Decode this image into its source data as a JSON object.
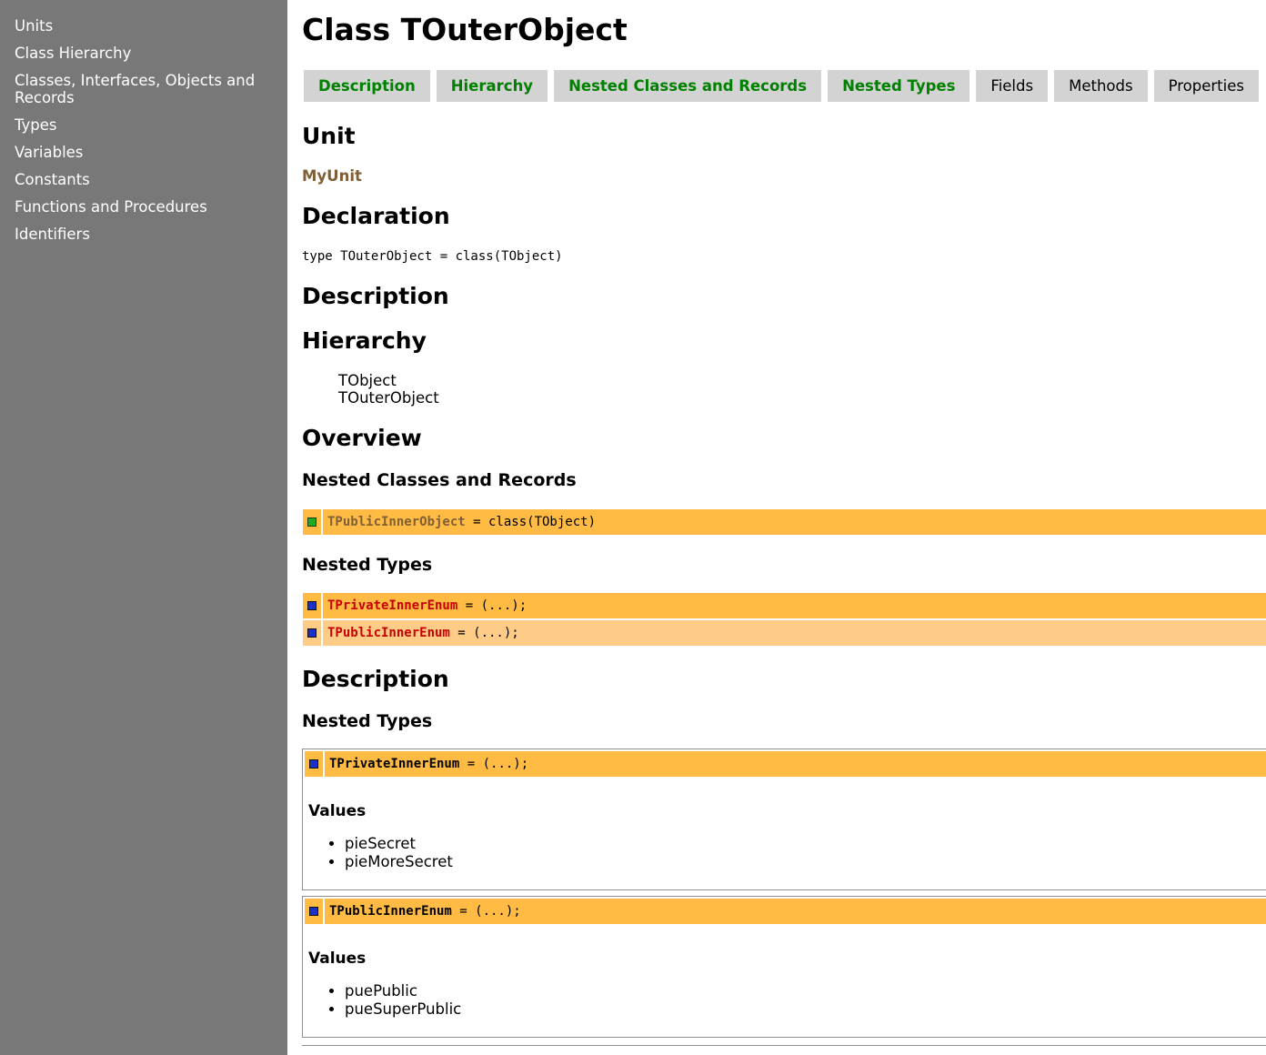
{
  "sidebar": {
    "items": [
      {
        "label": "Units"
      },
      {
        "label": "Class Hierarchy"
      },
      {
        "label": "Classes, Interfaces, Objects and Records"
      },
      {
        "label": "Types"
      },
      {
        "label": "Variables"
      },
      {
        "label": "Constants"
      },
      {
        "label": "Functions and Procedures"
      },
      {
        "label": "Identifiers"
      }
    ]
  },
  "page": {
    "title": "Class TOuterObject",
    "tabs": [
      {
        "label": "Description",
        "active": true
      },
      {
        "label": "Hierarchy",
        "active": true
      },
      {
        "label": "Nested Classes and Records",
        "active": true
      },
      {
        "label": "Nested Types",
        "active": true
      },
      {
        "label": "Fields",
        "active": false
      },
      {
        "label": "Methods",
        "active": false
      },
      {
        "label": "Properties",
        "active": false
      }
    ]
  },
  "unit": {
    "heading": "Unit",
    "name": "MyUnit"
  },
  "declaration": {
    "heading": "Declaration",
    "code": "type TOuterObject = class(TObject)"
  },
  "description": {
    "heading": "Description"
  },
  "hierarchy": {
    "heading": "Hierarchy",
    "items": [
      "TObject",
      "TOuterObject"
    ]
  },
  "overview": {
    "heading": "Overview",
    "nested_classes": {
      "heading": "Nested Classes and Records",
      "items": [
        {
          "name": "TPublicInnerObject",
          "rest": " = class(TObject)",
          "icon": "public-green-square-icon"
        }
      ]
    },
    "nested_types": {
      "heading": "Nested Types",
      "items": [
        {
          "name": "TPrivateInnerEnum",
          "rest": " = (...);",
          "icon": "private-blue-square-icon"
        },
        {
          "name": "TPublicInnerEnum",
          "rest": " = (...);",
          "icon": "public-blue-square-icon"
        }
      ]
    }
  },
  "details": {
    "heading": "Description",
    "nested_types_heading": "Nested Types",
    "types": [
      {
        "name": "TPrivateInnerEnum",
        "rest": " = (...);",
        "values_heading": "Values",
        "values": [
          "pieSecret",
          "pieMoreSecret"
        ]
      },
      {
        "name": "TPublicInnerEnum",
        "rest": " = (...);",
        "values_heading": "Values",
        "values": [
          "puePublic",
          "pueSuperPublic"
        ]
      }
    ]
  },
  "colors": {
    "sidebar_bg": "#787878",
    "tab_bg": "#d3d3d3",
    "tab_active_text": "#008000",
    "row_orange": "#ffbb44",
    "row_light_orange": "#ffcc88",
    "link_brown": "#7f5f36",
    "private_red": "#c80000"
  }
}
